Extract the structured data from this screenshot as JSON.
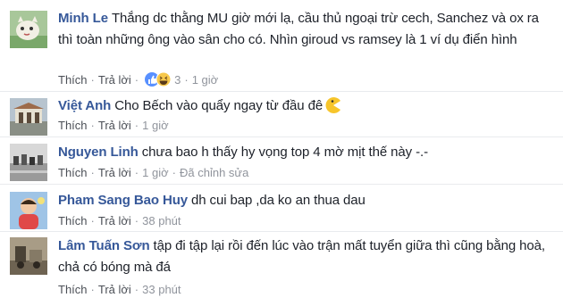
{
  "comments": [
    {
      "author": "Minh Le",
      "text": "Thắng dc thằng MU giờ mới lạ, cầu thủ ngoại trừ cech, Sanchez và ox ra thì toàn những ông vào sân cho có. Nhìn giroud vs ramsey là 1 ví dụ điển hình",
      "like": "Thích",
      "reply": "Trả lời",
      "reaction_count": "3",
      "time": "1 giờ",
      "reactions": [
        "like-icon",
        "haha-icon"
      ]
    },
    {
      "author": "Việt Anh",
      "text": "Cho Bếch vào quẩy ngay từ đầu đê",
      "emoji": "pacman-emoji",
      "like": "Thích",
      "reply": "Trả lời",
      "time": "1 giờ"
    },
    {
      "author": "Nguyen Linh",
      "text": "chưa bao h thấy hy vọng top 4 mờ mịt thế này -.-",
      "like": "Thích",
      "reply": "Trả lời",
      "time": "1 giờ",
      "edited": "Đã chỉnh sửa"
    },
    {
      "author": "Pham Sang Bao Huy",
      "text": "dh cui bap ,da ko an thua dau",
      "like": "Thích",
      "reply": "Trả lời",
      "time": "38 phút"
    },
    {
      "author": "Lâm Tuấn Sơn",
      "text": "tập đi tập lại rồi đến lúc vào trận mất tuyển giữa thì cũng bằng hoà, chả có bóng mà đá",
      "like": "Thích",
      "reply": "Trả lời",
      "time": "33 phút"
    }
  ],
  "colors": {
    "author": "#365899",
    "text": "#1d2129",
    "meta": "#90949c",
    "link": "#4b4f56",
    "divider": "#e9ebee"
  }
}
